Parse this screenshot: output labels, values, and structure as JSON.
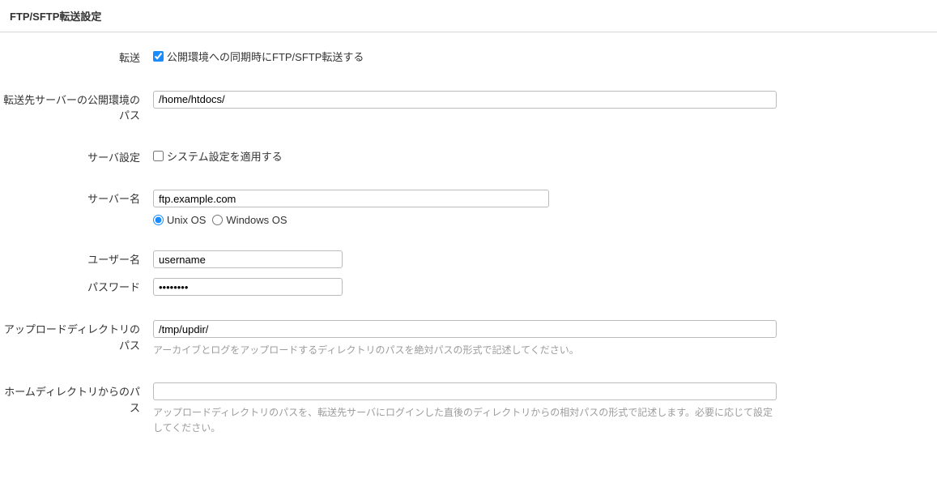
{
  "section": {
    "title": "FTP/SFTP転送設定"
  },
  "form": {
    "transfer": {
      "label": "転送",
      "checkbox_label": "公開環境への同期時にFTP/SFTP転送する",
      "checked": true
    },
    "server_path": {
      "label": "転送先サーバーの公開環境のパス",
      "value": "/home/htdocs/"
    },
    "server_settings": {
      "label": "サーバ設定",
      "checkbox_label": "システム設定を適用する",
      "checked": false
    },
    "server_name": {
      "label": "サーバー名",
      "value": "ftp.example.com",
      "os_options": {
        "unix": "Unix OS",
        "windows": "Windows OS",
        "selected": "unix"
      }
    },
    "username": {
      "label": "ユーザー名",
      "value": "username"
    },
    "password": {
      "label": "パスワード",
      "value": "••••••••"
    },
    "upload_dir": {
      "label": "アップロードディレクトリのパス",
      "value": "/tmp/updir/",
      "help": "アーカイブとログをアップロードするディレクトリのパスを絶対パスの形式で記述してください。"
    },
    "home_dir": {
      "label": "ホームディレクトリからのパス",
      "value": "",
      "help": "アップロードディレクトリのパスを、転送先サーバにログインした直後のディレクトリからの相対パスの形式で記述します。必要に応じて設定してください。"
    }
  }
}
